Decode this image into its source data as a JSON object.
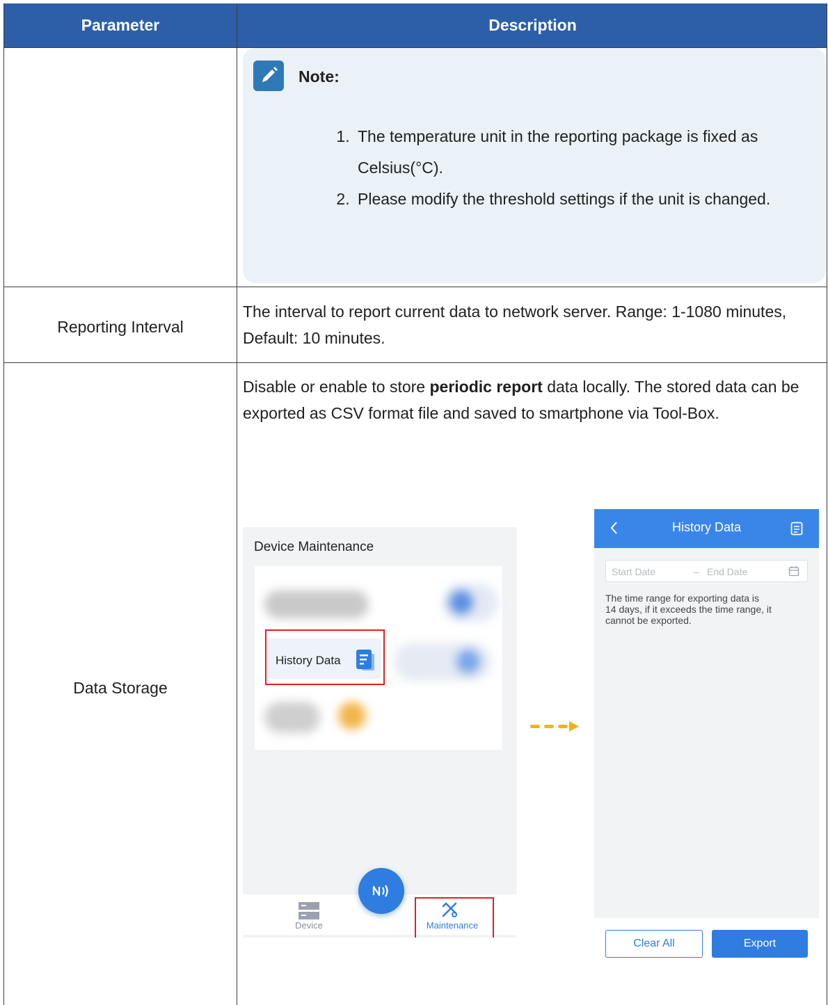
{
  "table": {
    "headers": {
      "parameter": "Parameter",
      "description": "Description"
    }
  },
  "note": {
    "title": "Note:",
    "items": [
      "The temperature unit in the reporting package is fixed as Celsius(°C).",
      "Please modify the threshold settings if the unit is changed."
    ]
  },
  "rows": {
    "reporting_interval": {
      "name": "Reporting Interval",
      "description": "The interval to report current data to network server. Range: 1-1080 minutes, Default: 10 minutes."
    },
    "data_storage": {
      "name": "Data Storage",
      "desc_before": "Disable or enable to store ",
      "desc_bold": "periodic report",
      "desc_after": " data locally. The stored data can be exported as CSV format file and saved to smartphone via Tool-Box."
    }
  },
  "left_screen": {
    "section_title": "Device Maintenance",
    "history_item": "History Data",
    "nav_device": "Device",
    "nav_maintenance": "Maintenance"
  },
  "right_screen": {
    "title": "History Data",
    "start_placeholder": "Start Date",
    "date_separator": "–",
    "end_placeholder": "End Date",
    "info_lines": [
      "The time range for exporting data is",
      "14 days, if it exceeds the time range, it",
      "cannot be exported."
    ],
    "clear_button": "Clear All",
    "export_button": "Export"
  },
  "colors": {
    "header_bg": "#2d5fa8",
    "note_bg": "#eaf2f8",
    "app_blue": "#2f7de0",
    "highlight_red": "#e02020",
    "arrow_orange": "#f2b21b"
  }
}
